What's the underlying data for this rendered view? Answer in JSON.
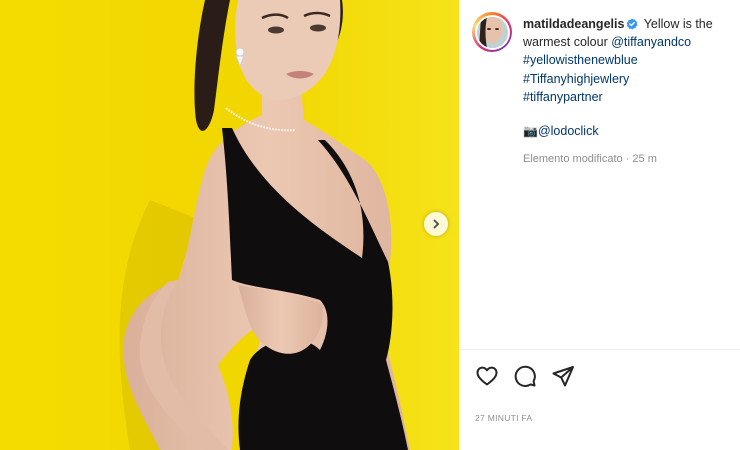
{
  "post": {
    "image_alt": "Woman in black dress against yellow backdrop",
    "next_icon": "chevron-right-icon"
  },
  "caption": {
    "username": "matildadeangelis",
    "verified": true,
    "text_intro": "Yellow is the warmest colour",
    "mention_brand": "@tiffanyandco",
    "hashtags": [
      "#yellowisthenewblue",
      "#Tiffanyhighjewlery",
      "#tiffanypartner"
    ],
    "camera_icon": "📷",
    "credit": "@lodoclick",
    "edited": "Elemento modificato · 25 m"
  },
  "actions": {
    "like_icon": "heart-icon",
    "comment_icon": "comment-icon",
    "share_icon": "send-icon"
  },
  "timestamp": "27 MINUTI FA",
  "colors": {
    "background_yellow": "#f1d800",
    "link": "#00376b",
    "muted": "#8e8e8e",
    "verified": "#3897f0"
  }
}
